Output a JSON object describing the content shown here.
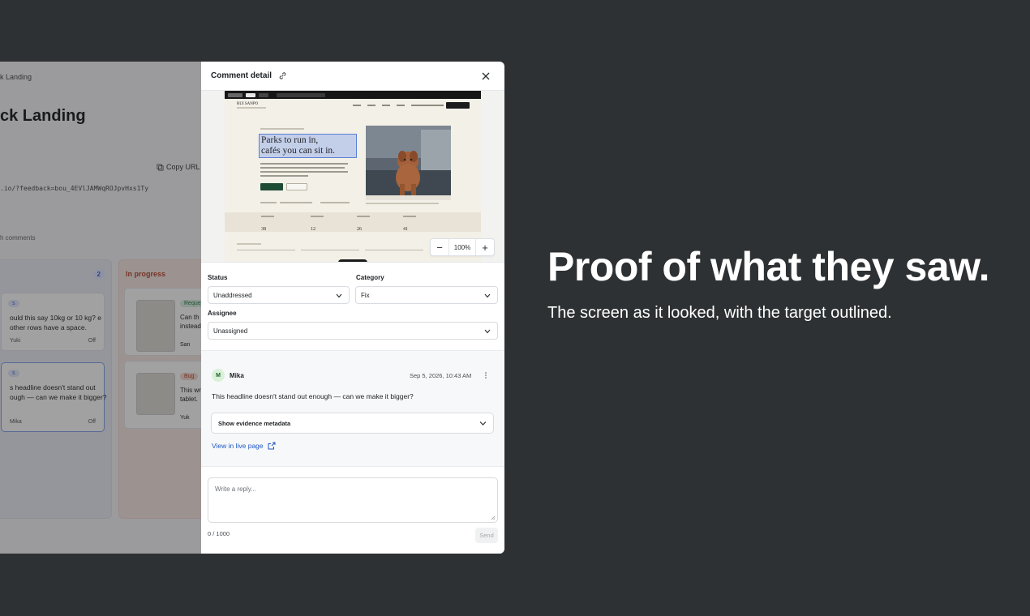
{
  "background_app": {
    "breadcrumb": "k Landing",
    "title": "ck Landing",
    "copy_url_label": "Copy URL",
    "url": ".io/?feedback=bou_4EVlJAMWqROJpvHxs1Ty",
    "tabs_text": "h comments",
    "columns": [
      {
        "title": "",
        "count": "2",
        "cards": [
          {
            "tag": "s",
            "text": "ould this say 10kg or 10 kg? e other rows have a space.",
            "author": "Yuki",
            "status": "Off"
          },
          {
            "tag": "s",
            "text": "s headline doesn't stand out ough — can we make it bigger?",
            "author": "Mika",
            "status": "Off"
          }
        ]
      },
      {
        "title": "In progress",
        "cards": [
          {
            "tag": "Reques",
            "text": "Can th instead",
            "author": "San"
          },
          {
            "tag": "Bug",
            "text": "This wra tablet.",
            "author": "Yuk"
          }
        ]
      }
    ]
  },
  "panel": {
    "title": "Comment detail",
    "preview": {
      "headline_line1": "Parks to run in,",
      "headline_line2": "cafés you can sit in.",
      "site_logo": "RUI SANPO",
      "stats": [
        "38",
        "12",
        "26",
        "41"
      ],
      "zoom": "100%"
    },
    "fields": {
      "status_label": "Status",
      "status_value": "Unaddressed",
      "category_label": "Category",
      "category_value": "Fix",
      "assignee_label": "Assignee",
      "assignee_value": "Unassigned"
    },
    "comment": {
      "avatar_initial": "M",
      "author": "Mika",
      "timestamp": "Sep 5, 2026, 10:43 AM",
      "body": "This headline doesn't stand out enough — can we make it bigger?",
      "evidence_label": "Show evidence metadata",
      "live_link": "View in live page"
    },
    "reply": {
      "placeholder": "Write a reply...",
      "char_count": "0 / 1000",
      "send_label": "Send"
    }
  },
  "marketing": {
    "headline": "Proof of what they saw.",
    "subline": "The screen as it looked, with the target outlined."
  },
  "colors": {
    "page_bg": "#2e3133",
    "highlight_border": "#5c7ed8",
    "link": "#2158c4"
  }
}
